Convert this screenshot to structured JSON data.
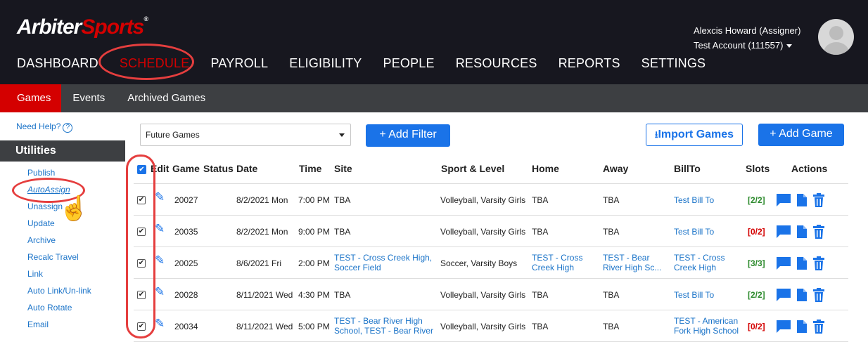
{
  "brand": {
    "part1": "Arbiter",
    "part2": "Sports",
    "reg": "®"
  },
  "nav": [
    "DASHBOARD",
    "SCHEDULE",
    "PAYROLL",
    "ELIGIBILITY",
    "PEOPLE",
    "RESOURCES",
    "REPORTS",
    "SETTINGS"
  ],
  "user": {
    "name": "Alexcis Howard (Assigner)",
    "account": "Test Account (111557)"
  },
  "subtabs": [
    "Games",
    "Events",
    "Archived Games"
  ],
  "sidebar": {
    "help": "Need Help?",
    "utilities_title": "Utilities",
    "items": [
      "Publish",
      "AutoAssign",
      "Unassign",
      "Update",
      "Archive",
      "Recalc Travel",
      "Link",
      "Auto Link/Un-link",
      "Auto Rotate",
      "Email"
    ]
  },
  "toolbar": {
    "filter_select": "Future Games",
    "add_filter": "Add Filter",
    "import_games": "Import Games",
    "add_game": "Add Game"
  },
  "table": {
    "headers": {
      "edit": "Edit",
      "game": "Game",
      "status": "Status",
      "date": "Date",
      "time": "Time",
      "site": "Site",
      "sport": "Sport & Level",
      "home": "Home",
      "away": "Away",
      "billto": "BillTo",
      "slots": "Slots",
      "actions": "Actions"
    },
    "rows": [
      {
        "game": "20027",
        "date": "8/2/2021 Mon",
        "time": "7:00 PM",
        "site": "TBA",
        "site_link": false,
        "sport": "Volleyball, Varsity Girls",
        "home": "TBA",
        "home_link": false,
        "away": "TBA",
        "away_link": false,
        "billto": "Test Bill To",
        "slots": "[2/2]",
        "slots_ok": true
      },
      {
        "game": "20035",
        "date": "8/2/2021 Mon",
        "time": "9:00 PM",
        "site": "TBA",
        "site_link": false,
        "sport": "Volleyball, Varsity Girls",
        "home": "TBA",
        "home_link": false,
        "away": "TBA",
        "away_link": false,
        "billto": "Test Bill To",
        "slots": "[0/2]",
        "slots_ok": false
      },
      {
        "game": "20025",
        "date": "8/6/2021 Fri",
        "time": "2:00 PM",
        "site": "TEST - Cross Creek High, Soccer Field",
        "site_link": true,
        "sport": "Soccer, Varsity Boys",
        "home": "TEST - Cross Creek High",
        "home_link": true,
        "away": "TEST - Bear River High Sc...",
        "away_link": true,
        "billto": "TEST - Cross Creek High",
        "slots": "[3/3]",
        "slots_ok": true
      },
      {
        "game": "20028",
        "date": "8/11/2021 Wed",
        "time": "4:30 PM",
        "site": "TBA",
        "site_link": false,
        "sport": "Volleyball, Varsity Girls",
        "home": "TBA",
        "home_link": false,
        "away": "TBA",
        "away_link": false,
        "billto": "Test Bill To",
        "slots": "[2/2]",
        "slots_ok": true
      },
      {
        "game": "20034",
        "date": "8/11/2021 Wed",
        "time": "5:00 PM",
        "site": "TEST - Bear River High School, TEST - Bear River High School",
        "site_link": true,
        "sport": "Volleyball, Varsity Girls",
        "home": "TBA",
        "home_link": false,
        "away": "TBA",
        "away_link": false,
        "billto": "TEST - American Fork High School",
        "slots": "[0/2]",
        "slots_ok": false
      }
    ]
  },
  "colors": {
    "brand_red": "#d40000",
    "accent_blue": "#1a73e8",
    "annotation_red": "#e53e3e",
    "topbar": "#17171f"
  }
}
